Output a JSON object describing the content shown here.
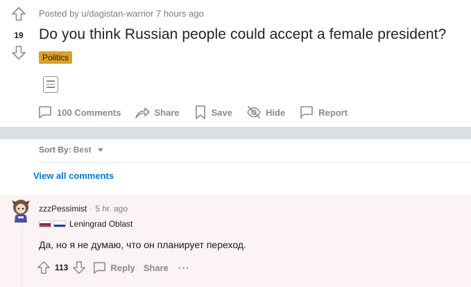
{
  "post": {
    "vote_count": "19",
    "meta": "Posted by u/dagistan-warrior 7 hours ago",
    "title": "Do you think Russian people could accept a female president?",
    "flair": "Politics",
    "flair_color": "#dda025",
    "actions": {
      "comments": "100 Comments",
      "share": "Share",
      "save": "Save",
      "hide": "Hide",
      "report": "Report"
    }
  },
  "sort": {
    "label": "Sort By:",
    "value": "Best"
  },
  "view_all": "View all comments",
  "comment": {
    "author": "zzzPessimist",
    "separator": "·",
    "time": "5 hr. ago",
    "flair_text": "Leningrad Oblast",
    "body": "Да, но я не думаю, что он планирует переход.",
    "score": "113",
    "reply": "Reply",
    "share": "Share",
    "more": "···"
  },
  "colors": {
    "link_blue": "#0079d3",
    "muted_gray": "#878a8c",
    "separator_bg": "#dae0e6",
    "comment_highlight_bg": "#fcf3f4"
  }
}
